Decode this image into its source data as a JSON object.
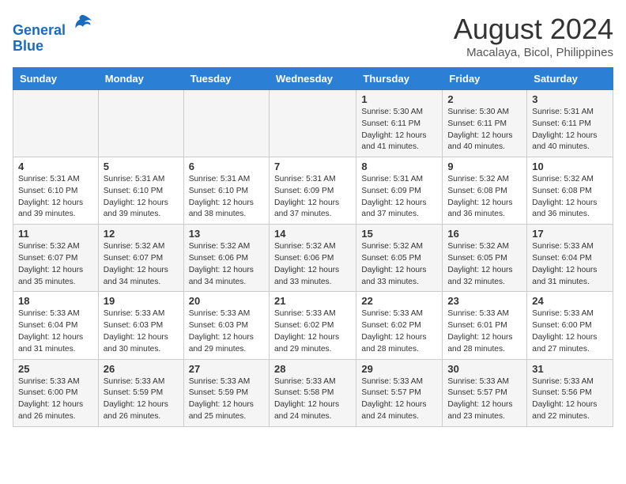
{
  "header": {
    "logo_line1": "General",
    "logo_line2": "Blue",
    "month": "August 2024",
    "location": "Macalaya, Bicol, Philippines"
  },
  "days_of_week": [
    "Sunday",
    "Monday",
    "Tuesday",
    "Wednesday",
    "Thursday",
    "Friday",
    "Saturday"
  ],
  "weeks": [
    [
      {
        "num": "",
        "info": ""
      },
      {
        "num": "",
        "info": ""
      },
      {
        "num": "",
        "info": ""
      },
      {
        "num": "",
        "info": ""
      },
      {
        "num": "1",
        "info": "Sunrise: 5:30 AM\nSunset: 6:11 PM\nDaylight: 12 hours\nand 41 minutes."
      },
      {
        "num": "2",
        "info": "Sunrise: 5:30 AM\nSunset: 6:11 PM\nDaylight: 12 hours\nand 40 minutes."
      },
      {
        "num": "3",
        "info": "Sunrise: 5:31 AM\nSunset: 6:11 PM\nDaylight: 12 hours\nand 40 minutes."
      }
    ],
    [
      {
        "num": "4",
        "info": "Sunrise: 5:31 AM\nSunset: 6:10 PM\nDaylight: 12 hours\nand 39 minutes."
      },
      {
        "num": "5",
        "info": "Sunrise: 5:31 AM\nSunset: 6:10 PM\nDaylight: 12 hours\nand 39 minutes."
      },
      {
        "num": "6",
        "info": "Sunrise: 5:31 AM\nSunset: 6:10 PM\nDaylight: 12 hours\nand 38 minutes."
      },
      {
        "num": "7",
        "info": "Sunrise: 5:31 AM\nSunset: 6:09 PM\nDaylight: 12 hours\nand 37 minutes."
      },
      {
        "num": "8",
        "info": "Sunrise: 5:31 AM\nSunset: 6:09 PM\nDaylight: 12 hours\nand 37 minutes."
      },
      {
        "num": "9",
        "info": "Sunrise: 5:32 AM\nSunset: 6:08 PM\nDaylight: 12 hours\nand 36 minutes."
      },
      {
        "num": "10",
        "info": "Sunrise: 5:32 AM\nSunset: 6:08 PM\nDaylight: 12 hours\nand 36 minutes."
      }
    ],
    [
      {
        "num": "11",
        "info": "Sunrise: 5:32 AM\nSunset: 6:07 PM\nDaylight: 12 hours\nand 35 minutes."
      },
      {
        "num": "12",
        "info": "Sunrise: 5:32 AM\nSunset: 6:07 PM\nDaylight: 12 hours\nand 34 minutes."
      },
      {
        "num": "13",
        "info": "Sunrise: 5:32 AM\nSunset: 6:06 PM\nDaylight: 12 hours\nand 34 minutes."
      },
      {
        "num": "14",
        "info": "Sunrise: 5:32 AM\nSunset: 6:06 PM\nDaylight: 12 hours\nand 33 minutes."
      },
      {
        "num": "15",
        "info": "Sunrise: 5:32 AM\nSunset: 6:05 PM\nDaylight: 12 hours\nand 33 minutes."
      },
      {
        "num": "16",
        "info": "Sunrise: 5:32 AM\nSunset: 6:05 PM\nDaylight: 12 hours\nand 32 minutes."
      },
      {
        "num": "17",
        "info": "Sunrise: 5:33 AM\nSunset: 6:04 PM\nDaylight: 12 hours\nand 31 minutes."
      }
    ],
    [
      {
        "num": "18",
        "info": "Sunrise: 5:33 AM\nSunset: 6:04 PM\nDaylight: 12 hours\nand 31 minutes."
      },
      {
        "num": "19",
        "info": "Sunrise: 5:33 AM\nSunset: 6:03 PM\nDaylight: 12 hours\nand 30 minutes."
      },
      {
        "num": "20",
        "info": "Sunrise: 5:33 AM\nSunset: 6:03 PM\nDaylight: 12 hours\nand 29 minutes."
      },
      {
        "num": "21",
        "info": "Sunrise: 5:33 AM\nSunset: 6:02 PM\nDaylight: 12 hours\nand 29 minutes."
      },
      {
        "num": "22",
        "info": "Sunrise: 5:33 AM\nSunset: 6:02 PM\nDaylight: 12 hours\nand 28 minutes."
      },
      {
        "num": "23",
        "info": "Sunrise: 5:33 AM\nSunset: 6:01 PM\nDaylight: 12 hours\nand 28 minutes."
      },
      {
        "num": "24",
        "info": "Sunrise: 5:33 AM\nSunset: 6:00 PM\nDaylight: 12 hours\nand 27 minutes."
      }
    ],
    [
      {
        "num": "25",
        "info": "Sunrise: 5:33 AM\nSunset: 6:00 PM\nDaylight: 12 hours\nand 26 minutes."
      },
      {
        "num": "26",
        "info": "Sunrise: 5:33 AM\nSunset: 5:59 PM\nDaylight: 12 hours\nand 26 minutes."
      },
      {
        "num": "27",
        "info": "Sunrise: 5:33 AM\nSunset: 5:59 PM\nDaylight: 12 hours\nand 25 minutes."
      },
      {
        "num": "28",
        "info": "Sunrise: 5:33 AM\nSunset: 5:58 PM\nDaylight: 12 hours\nand 24 minutes."
      },
      {
        "num": "29",
        "info": "Sunrise: 5:33 AM\nSunset: 5:57 PM\nDaylight: 12 hours\nand 24 minutes."
      },
      {
        "num": "30",
        "info": "Sunrise: 5:33 AM\nSunset: 5:57 PM\nDaylight: 12 hours\nand 23 minutes."
      },
      {
        "num": "31",
        "info": "Sunrise: 5:33 AM\nSunset: 5:56 PM\nDaylight: 12 hours\nand 22 minutes."
      }
    ]
  ]
}
